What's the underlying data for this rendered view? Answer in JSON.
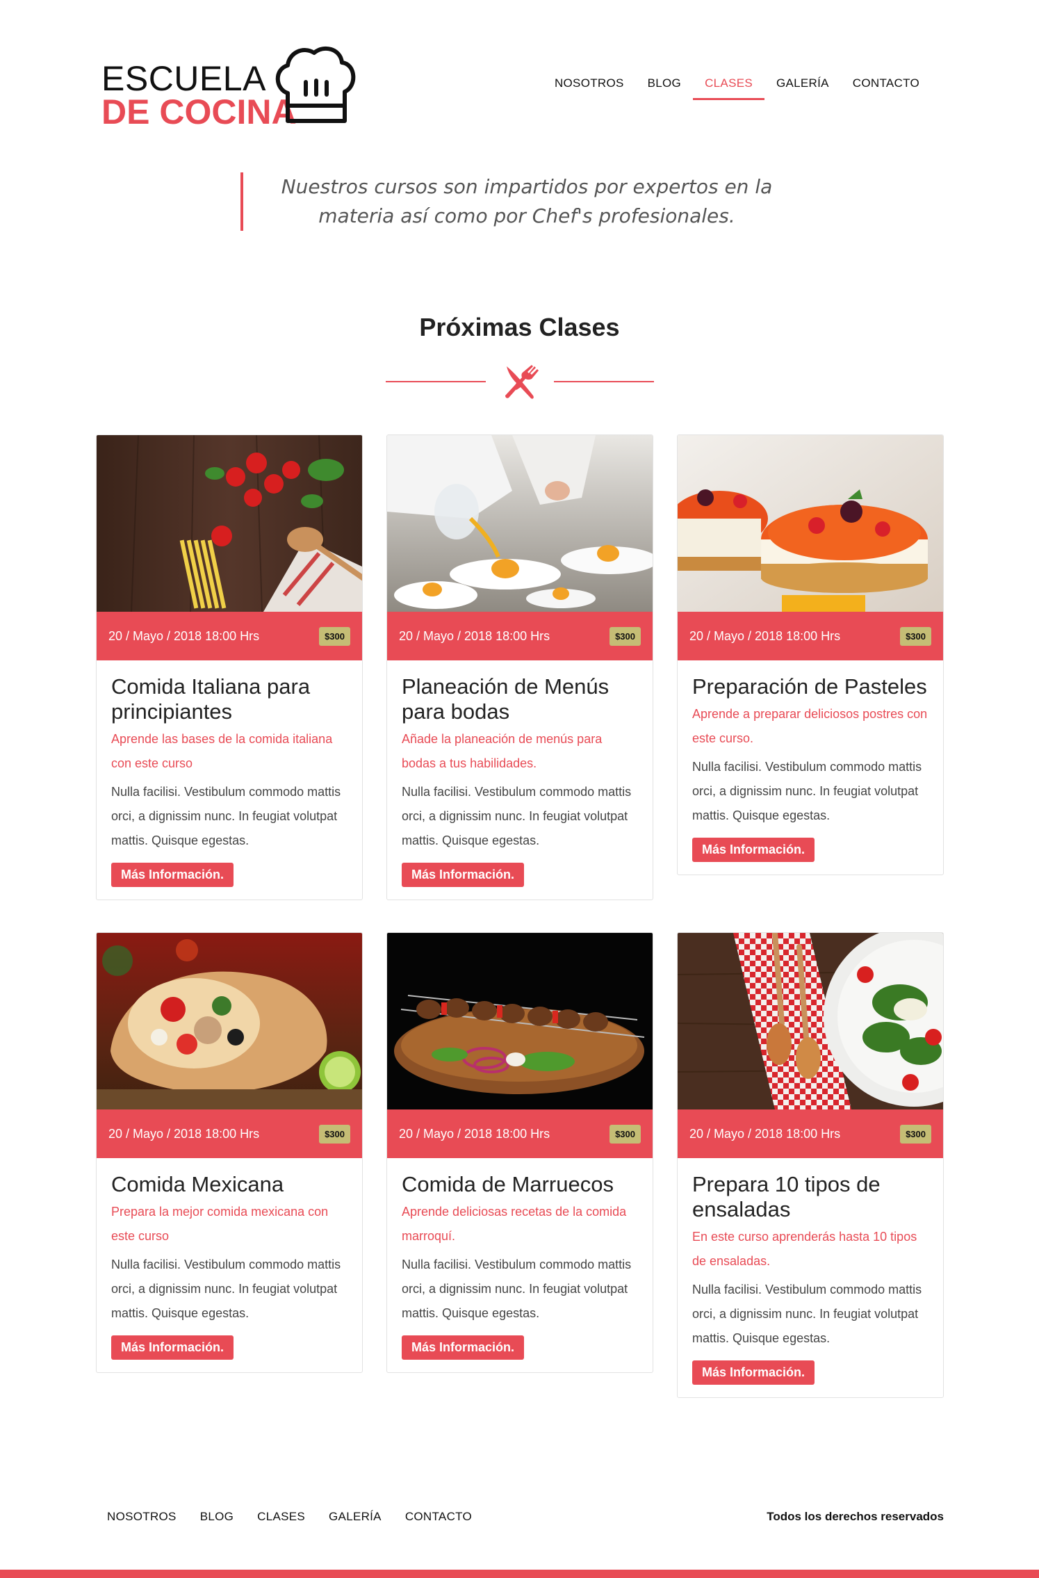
{
  "brand": {
    "line1": "ESCUELA",
    "line2": "DE COCINA",
    "accent": "#e84b55",
    "hat_icon": "chef-hat-icon"
  },
  "nav": {
    "items": [
      {
        "label": "NOSOTROS",
        "active": false
      },
      {
        "label": "BLOG",
        "active": false
      },
      {
        "label": "CLASES",
        "active": true
      },
      {
        "label": "GALERÍA",
        "active": false
      },
      {
        "label": "CONTACTO",
        "active": false
      }
    ]
  },
  "quote": {
    "text": "Nuestros cursos son impartidos por expertos en la materia así como por Chef's profesionales."
  },
  "section": {
    "title": "Próximas Clases",
    "divider_icon": "fork-knife-icon"
  },
  "cards": [
    {
      "image": "tomatoes-pasta-photo",
      "date": "20 / Mayo / 2018 18:00 Hrs",
      "price": "$300",
      "title": "Comida Italiana para principiantes",
      "subtitle": "Aprende las bases de la comida italiana con este curso",
      "text": "Nulla facilisi. Vestibulum commodo mattis orci, a dignissim nunc. In feugiat volutpat mattis. Quisque egestas.",
      "button": "Más Información."
    },
    {
      "image": "chef-plating-photo",
      "date": "20 / Mayo / 2018 18:00 Hrs",
      "price": "$300",
      "title": "Planeación de Menús para bodas",
      "subtitle": "Añade la planeación de menús para bodas a tus habilidades.",
      "text": "Nulla facilisi. Vestibulum commodo mattis orci, a dignissim nunc. In feugiat volutpat mattis. Quisque egestas.",
      "button": "Más Información."
    },
    {
      "image": "cheesecake-photo",
      "date": "20 / Mayo / 2018 18:00 Hrs",
      "price": "$300",
      "title": "Preparación de Pasteles",
      "subtitle": "Aprende a preparar deliciosos postres con este curso.",
      "text": "Nulla facilisi. Vestibulum commodo mattis orci, a dignissim nunc. In feugiat volutpat mattis. Quisque egestas.",
      "button": "Más Información."
    },
    {
      "image": "burrito-photo",
      "date": "20 / Mayo / 2018 18:00 Hrs",
      "price": "$300",
      "title": "Comida Mexicana",
      "subtitle": "Prepara la mejor comida mexicana con este curso",
      "text": "Nulla facilisi. Vestibulum commodo mattis orci, a dignissim nunc. In feugiat volutpat mattis. Quisque egestas.",
      "button": "Más Información."
    },
    {
      "image": "kebab-photo",
      "date": "20 / Mayo / 2018 18:00 Hrs",
      "price": "$300",
      "title": "Comida de Marruecos",
      "subtitle": "Aprende deliciosas recetas de la comida marroquí.",
      "text": "Nulla facilisi. Vestibulum commodo mattis orci, a dignissim nunc. In feugiat volutpat mattis. Quisque egestas.",
      "button": "Más Información."
    },
    {
      "image": "salad-photo",
      "date": "20 / Mayo / 2018 18:00 Hrs",
      "price": "$300",
      "title": "Prepara 10 tipos de ensaladas",
      "subtitle": "En este curso aprenderás hasta 10 tipos de ensaladas.",
      "text": "Nulla facilisi. Vestibulum commodo mattis orci, a dignissim nunc. In feugiat volutpat mattis. Quisque egestas.",
      "button": "Más Información."
    }
  ],
  "footer": {
    "items": [
      "NOSOTROS",
      "BLOG",
      "CLASES",
      "GALERÍA",
      "CONTACTO"
    ],
    "rights": "Todos los derechos reservados"
  }
}
